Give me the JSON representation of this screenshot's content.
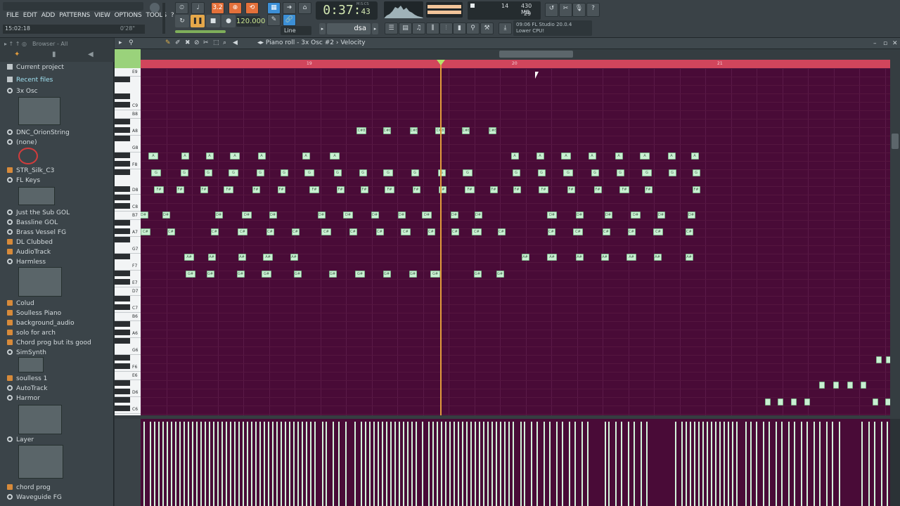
{
  "menu": [
    "FILE",
    "EDIT",
    "ADD",
    "PATTERNS",
    "VIEW",
    "OPTIONS",
    "TOOLS",
    "?"
  ],
  "hint_left": "15:02:18",
  "hint_right": "0'28\"",
  "transport": {
    "pattern_label": "PAT",
    "song_label": "SONG",
    "tempo": "120.000"
  },
  "time": {
    "main": "0:37",
    "sub": "43",
    "unit": "M:S:CS"
  },
  "cpu": {
    "voices": "14",
    "memory": "430 MB",
    "poly": "29"
  },
  "hint_panel": {
    "line1": "09:06 FL Studio 20.0.4",
    "line2": "Lower CPU!"
  },
  "snap": "dsa",
  "tool_mode": "Line",
  "browser": {
    "title": "Browser - All",
    "items": [
      {
        "label": "Current project",
        "icon": "doc"
      },
      {
        "label": "Recent files",
        "icon": "doc"
      },
      {
        "label": "3x Osc",
        "icon": "gear"
      },
      {
        "label": "DNC_OrionString",
        "icon": "gear"
      },
      {
        "label": "(none)",
        "icon": "gear"
      },
      {
        "label": "STR_Silk_C3",
        "icon": "folder"
      },
      {
        "label": "FL Keys",
        "icon": "gear"
      },
      {
        "label": "Just the Sub GOL",
        "icon": "gear"
      },
      {
        "label": "Bassline GOL",
        "icon": "gear"
      },
      {
        "label": "Brass Vessel FG",
        "icon": "gear"
      },
      {
        "label": "DL Clubbed",
        "icon": "folder"
      },
      {
        "label": "AudioTrack",
        "icon": "folder"
      },
      {
        "label": "Harmless",
        "icon": "gear"
      },
      {
        "label": "Colud",
        "icon": "folder"
      },
      {
        "label": "Soulless Piano",
        "icon": "folder"
      },
      {
        "label": "background_audio",
        "icon": "folder"
      },
      {
        "label": "solo for arch",
        "icon": "folder"
      },
      {
        "label": "Chord prog but its good",
        "icon": "folder"
      },
      {
        "label": "SimSynth",
        "icon": "gear"
      },
      {
        "label": "soulless 1",
        "icon": "folder"
      },
      {
        "label": "AutoTrack",
        "icon": "gear"
      },
      {
        "label": "Harmor",
        "icon": "gear"
      },
      {
        "label": "Layer",
        "icon": "gear"
      },
      {
        "label": "chord prog",
        "icon": "folder"
      },
      {
        "label": "Waveguide FG",
        "icon": "gear"
      }
    ]
  },
  "piano_roll": {
    "title": "Piano roll - 3x Osc #2",
    "target": "Velocity",
    "bars": [
      "19",
      "20",
      "21"
    ],
    "keys": [
      "E9",
      "C9",
      "B8",
      "A8",
      "G8",
      "F8",
      "D8",
      "C8",
      "B7",
      "A7",
      "G7",
      "F7",
      "E7",
      "D7",
      "C7",
      "B6",
      "A6",
      "G6",
      "F6",
      "E6",
      "D6",
      "C6"
    ]
  },
  "colors": {
    "grid": "#490b37",
    "note": "#c9f0d2",
    "timeline": "#d1455c",
    "playhead": "#e39d3c"
  }
}
